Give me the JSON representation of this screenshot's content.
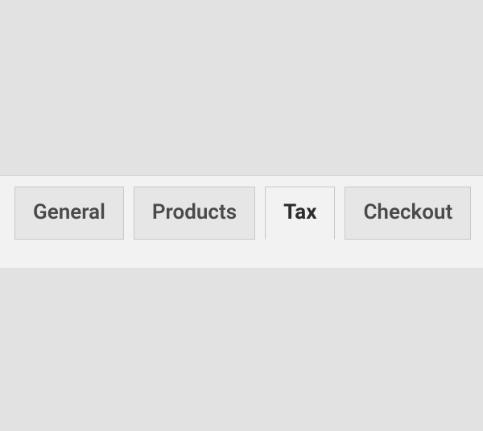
{
  "tabs": [
    {
      "label": "General",
      "active": false
    },
    {
      "label": "Products",
      "active": false
    },
    {
      "label": "Tax",
      "active": true
    },
    {
      "label": "Checkout",
      "active": false
    }
  ]
}
